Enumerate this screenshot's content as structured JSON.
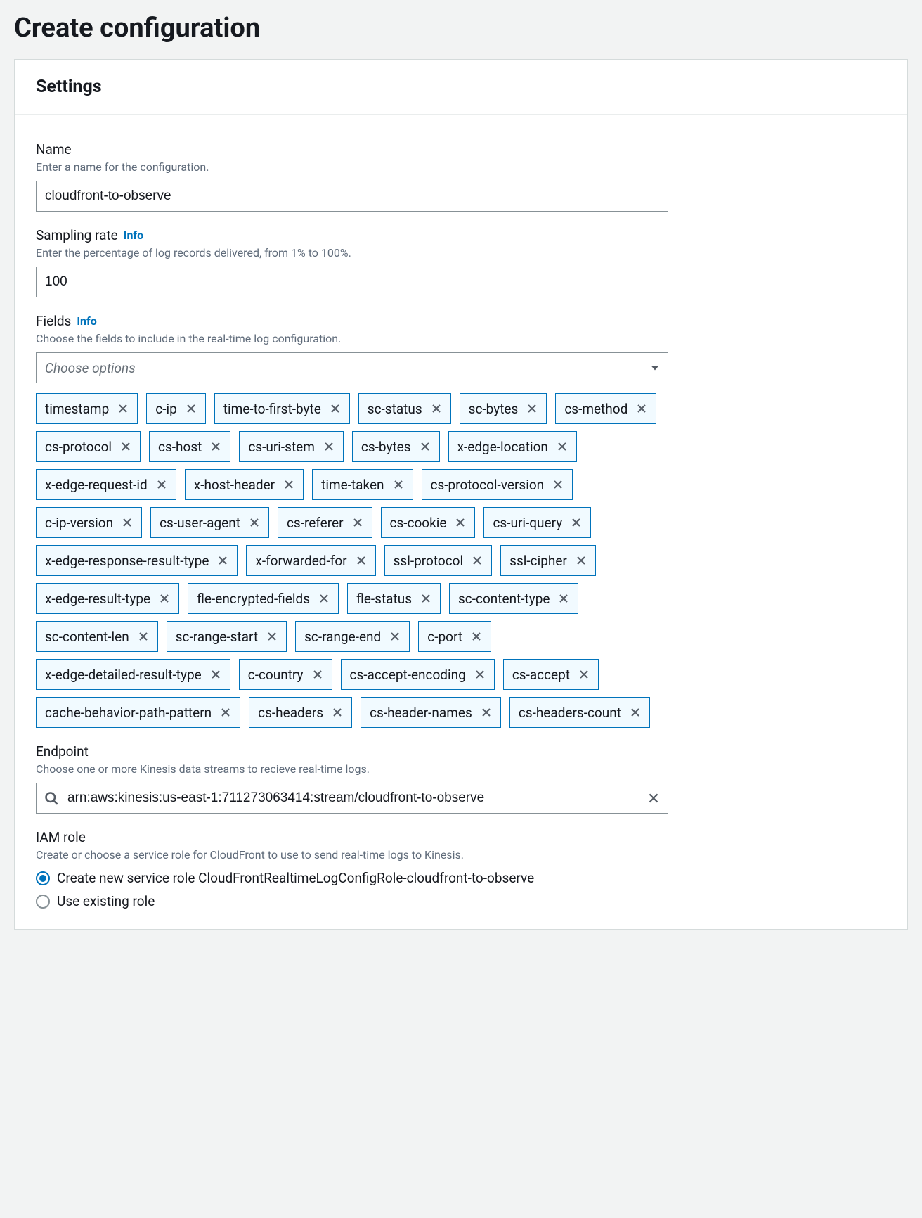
{
  "page_title": "Create configuration",
  "panel_title": "Settings",
  "name": {
    "label": "Name",
    "hint": "Enter a name for the configuration.",
    "value": "cloudfront-to-observe"
  },
  "sampling_rate": {
    "label": "Sampling rate",
    "info": "Info",
    "hint": "Enter the percentage of log records delivered, from 1% to 100%.",
    "value": "100"
  },
  "fields": {
    "label": "Fields",
    "info": "Info",
    "hint": "Choose the fields to include in the real-time log configuration.",
    "placeholder": "Choose options",
    "selected": [
      "timestamp",
      "c-ip",
      "time-to-first-byte",
      "sc-status",
      "sc-bytes",
      "cs-method",
      "cs-protocol",
      "cs-host",
      "cs-uri-stem",
      "cs-bytes",
      "x-edge-location",
      "x-edge-request-id",
      "x-host-header",
      "time-taken",
      "cs-protocol-version",
      "c-ip-version",
      "cs-user-agent",
      "cs-referer",
      "cs-cookie",
      "cs-uri-query",
      "x-edge-response-result-type",
      "x-forwarded-for",
      "ssl-protocol",
      "ssl-cipher",
      "x-edge-result-type",
      "fle-encrypted-fields",
      "fle-status",
      "sc-content-type",
      "sc-content-len",
      "sc-range-start",
      "sc-range-end",
      "c-port",
      "x-edge-detailed-result-type",
      "c-country",
      "cs-accept-encoding",
      "cs-accept",
      "cache-behavior-path-pattern",
      "cs-headers",
      "cs-header-names",
      "cs-headers-count"
    ]
  },
  "endpoint": {
    "label": "Endpoint",
    "hint": "Choose one or more Kinesis data streams to recieve real-time logs.",
    "value": "arn:aws:kinesis:us-east-1:711273063414:stream/cloudfront-to-observe"
  },
  "iam_role": {
    "label": "IAM role",
    "hint": "Create or choose a service role for CloudFront to use to send real-time logs to Kinesis.",
    "options": [
      {
        "label": "Create new service role CloudFrontRealtimeLogConfigRole-cloudfront-to-observe",
        "checked": true
      },
      {
        "label": "Use existing role",
        "checked": false
      }
    ]
  }
}
